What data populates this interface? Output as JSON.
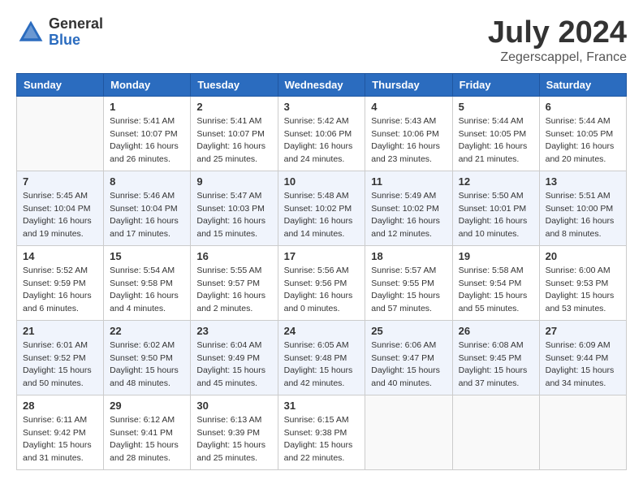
{
  "header": {
    "logo_general": "General",
    "logo_blue": "Blue",
    "month_title": "July 2024",
    "location": "Zegerscappel, France"
  },
  "days_of_week": [
    "Sunday",
    "Monday",
    "Tuesday",
    "Wednesday",
    "Thursday",
    "Friday",
    "Saturday"
  ],
  "weeks": [
    [
      {
        "day": "",
        "sunrise": "",
        "sunset": "",
        "daylight": ""
      },
      {
        "day": "1",
        "sunrise": "5:41 AM",
        "sunset": "10:07 PM",
        "daylight": "16 hours and 26 minutes."
      },
      {
        "day": "2",
        "sunrise": "5:41 AM",
        "sunset": "10:07 PM",
        "daylight": "16 hours and 25 minutes."
      },
      {
        "day": "3",
        "sunrise": "5:42 AM",
        "sunset": "10:06 PM",
        "daylight": "16 hours and 24 minutes."
      },
      {
        "day": "4",
        "sunrise": "5:43 AM",
        "sunset": "10:06 PM",
        "daylight": "16 hours and 23 minutes."
      },
      {
        "day": "5",
        "sunrise": "5:44 AM",
        "sunset": "10:05 PM",
        "daylight": "16 hours and 21 minutes."
      },
      {
        "day": "6",
        "sunrise": "5:44 AM",
        "sunset": "10:05 PM",
        "daylight": "16 hours and 20 minutes."
      }
    ],
    [
      {
        "day": "7",
        "sunrise": "5:45 AM",
        "sunset": "10:04 PM",
        "daylight": "16 hours and 19 minutes."
      },
      {
        "day": "8",
        "sunrise": "5:46 AM",
        "sunset": "10:04 PM",
        "daylight": "16 hours and 17 minutes."
      },
      {
        "day": "9",
        "sunrise": "5:47 AM",
        "sunset": "10:03 PM",
        "daylight": "16 hours and 15 minutes."
      },
      {
        "day": "10",
        "sunrise": "5:48 AM",
        "sunset": "10:02 PM",
        "daylight": "16 hours and 14 minutes."
      },
      {
        "day": "11",
        "sunrise": "5:49 AM",
        "sunset": "10:02 PM",
        "daylight": "16 hours and 12 minutes."
      },
      {
        "day": "12",
        "sunrise": "5:50 AM",
        "sunset": "10:01 PM",
        "daylight": "16 hours and 10 minutes."
      },
      {
        "day": "13",
        "sunrise": "5:51 AM",
        "sunset": "10:00 PM",
        "daylight": "16 hours and 8 minutes."
      }
    ],
    [
      {
        "day": "14",
        "sunrise": "5:52 AM",
        "sunset": "9:59 PM",
        "daylight": "16 hours and 6 minutes."
      },
      {
        "day": "15",
        "sunrise": "5:54 AM",
        "sunset": "9:58 PM",
        "daylight": "16 hours and 4 minutes."
      },
      {
        "day": "16",
        "sunrise": "5:55 AM",
        "sunset": "9:57 PM",
        "daylight": "16 hours and 2 minutes."
      },
      {
        "day": "17",
        "sunrise": "5:56 AM",
        "sunset": "9:56 PM",
        "daylight": "16 hours and 0 minutes."
      },
      {
        "day": "18",
        "sunrise": "5:57 AM",
        "sunset": "9:55 PM",
        "daylight": "15 hours and 57 minutes."
      },
      {
        "day": "19",
        "sunrise": "5:58 AM",
        "sunset": "9:54 PM",
        "daylight": "15 hours and 55 minutes."
      },
      {
        "day": "20",
        "sunrise": "6:00 AM",
        "sunset": "9:53 PM",
        "daylight": "15 hours and 53 minutes."
      }
    ],
    [
      {
        "day": "21",
        "sunrise": "6:01 AM",
        "sunset": "9:52 PM",
        "daylight": "15 hours and 50 minutes."
      },
      {
        "day": "22",
        "sunrise": "6:02 AM",
        "sunset": "9:50 PM",
        "daylight": "15 hours and 48 minutes."
      },
      {
        "day": "23",
        "sunrise": "6:04 AM",
        "sunset": "9:49 PM",
        "daylight": "15 hours and 45 minutes."
      },
      {
        "day": "24",
        "sunrise": "6:05 AM",
        "sunset": "9:48 PM",
        "daylight": "15 hours and 42 minutes."
      },
      {
        "day": "25",
        "sunrise": "6:06 AM",
        "sunset": "9:47 PM",
        "daylight": "15 hours and 40 minutes."
      },
      {
        "day": "26",
        "sunrise": "6:08 AM",
        "sunset": "9:45 PM",
        "daylight": "15 hours and 37 minutes."
      },
      {
        "day": "27",
        "sunrise": "6:09 AM",
        "sunset": "9:44 PM",
        "daylight": "15 hours and 34 minutes."
      }
    ],
    [
      {
        "day": "28",
        "sunrise": "6:11 AM",
        "sunset": "9:42 PM",
        "daylight": "15 hours and 31 minutes."
      },
      {
        "day": "29",
        "sunrise": "6:12 AM",
        "sunset": "9:41 PM",
        "daylight": "15 hours and 28 minutes."
      },
      {
        "day": "30",
        "sunrise": "6:13 AM",
        "sunset": "9:39 PM",
        "daylight": "15 hours and 25 minutes."
      },
      {
        "day": "31",
        "sunrise": "6:15 AM",
        "sunset": "9:38 PM",
        "daylight": "15 hours and 22 minutes."
      },
      {
        "day": "",
        "sunrise": "",
        "sunset": "",
        "daylight": ""
      },
      {
        "day": "",
        "sunrise": "",
        "sunset": "",
        "daylight": ""
      },
      {
        "day": "",
        "sunrise": "",
        "sunset": "",
        "daylight": ""
      }
    ]
  ]
}
